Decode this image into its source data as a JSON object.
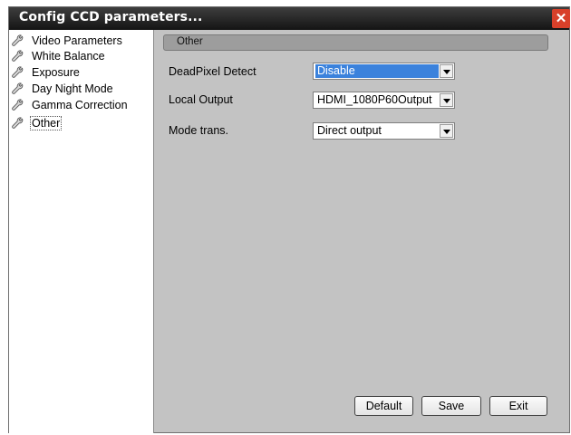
{
  "window": {
    "title": "Config CCD parameters...",
    "close_glyph": "✕"
  },
  "sidebar": {
    "items": [
      {
        "label": "Video Parameters",
        "icon": "wrench-icon"
      },
      {
        "label": "White Balance",
        "icon": "wrench-icon"
      },
      {
        "label": "Exposure",
        "icon": "wrench-icon"
      },
      {
        "label": "Day Night Mode",
        "icon": "wrench-icon"
      },
      {
        "label": "Gamma Correction",
        "icon": "wrench-icon"
      },
      {
        "label": "Other",
        "icon": "wrench-icon",
        "selected": true
      }
    ]
  },
  "main": {
    "section_title": "Other",
    "fields": [
      {
        "label": "DeadPixel Detect",
        "value": "Disable",
        "highlighted": true
      },
      {
        "label": "Local Output",
        "value": "HDMI_1080P60Output"
      },
      {
        "label": "Mode trans.",
        "value": "Direct output"
      }
    ]
  },
  "buttons": {
    "default": "Default",
    "save": "Save",
    "exit": "Exit"
  },
  "colors": {
    "selection": "#3b82dc",
    "close": "#d8402a",
    "panel": "#c3c3c3"
  }
}
